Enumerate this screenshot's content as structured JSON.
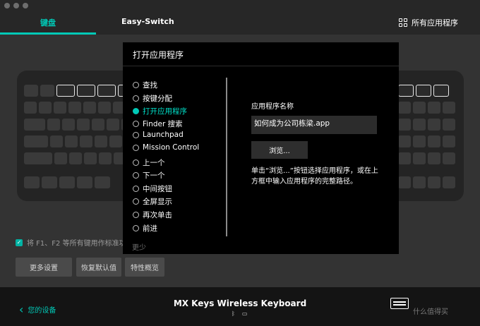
{
  "window": {
    "tabs": [
      {
        "label": "键盘"
      },
      {
        "label": "Easy-Switch"
      }
    ],
    "all_apps_label": "所有应用程序"
  },
  "settings": {
    "fkeys_label": "将 F1、F2 等所有键用作标准功",
    "buttons": {
      "more": "更多设置",
      "restore": "恢复默认值",
      "tour": "特性概览"
    }
  },
  "modal": {
    "title": "打开应用程序",
    "options": [
      {
        "label": "查找",
        "selected": false
      },
      {
        "label": "按键分配",
        "selected": false
      },
      {
        "label": "打开应用程序",
        "selected": true
      },
      {
        "label": "Finder 搜索",
        "selected": false
      },
      {
        "label": "Launchpad",
        "selected": false
      },
      {
        "label": "Mission Control",
        "selected": false
      },
      {
        "label": "上一个",
        "selected": false
      },
      {
        "label": "下一个",
        "selected": false
      },
      {
        "label": "中间按钮",
        "selected": false
      },
      {
        "label": "全屏显示",
        "selected": false
      },
      {
        "label": "再次单击",
        "selected": false
      },
      {
        "label": "前进",
        "selected": false
      }
    ],
    "less_label": "更少",
    "field_label": "应用程序名称",
    "field_value": "如何成为公司栋梁.app",
    "browse_label": "浏览...",
    "help_text": "单击“浏览...”按钮选择应用程序，或在上方框中输入应用程序的完整路径。"
  },
  "footer": {
    "back_label": "您的设备",
    "device_name": "MX Keys Wireless Keyboard",
    "watermark": "什么值得买"
  },
  "colors": {
    "accent": "#00c9b7",
    "modal_bg": "#000000",
    "footer_bg": "#141414"
  }
}
